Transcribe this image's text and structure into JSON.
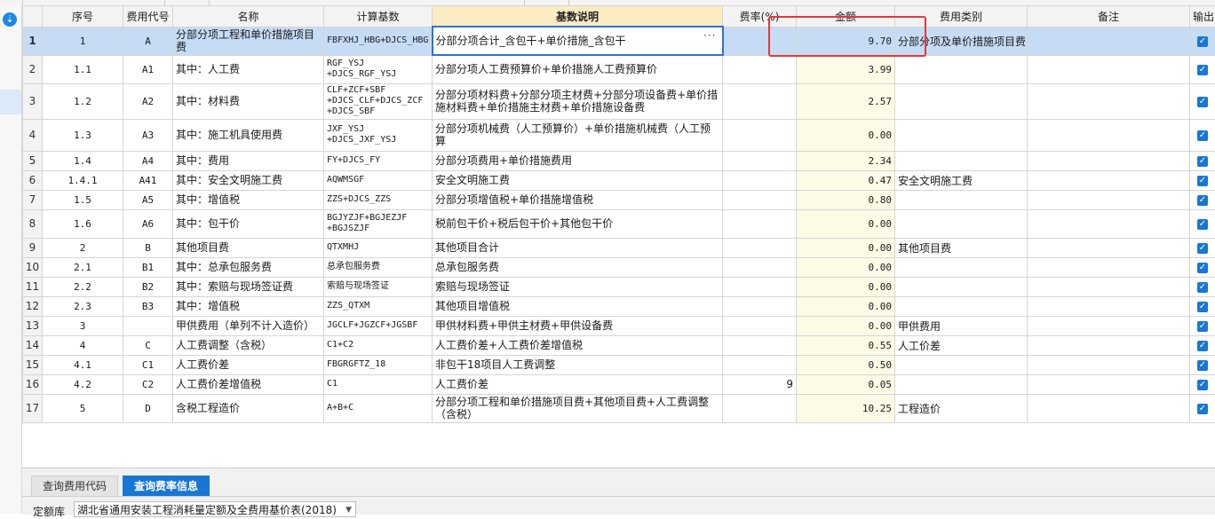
{
  "columns": {
    "seq": "序号",
    "code": "费用代号",
    "name": "名称",
    "base": "计算基数",
    "desc": "基数说明",
    "rate": "费率(%)",
    "amount": "金额",
    "category": "费用类别",
    "remark": "备注",
    "output": "输出"
  },
  "rows": [
    {
      "no": "1",
      "seq": "1",
      "code": "A",
      "name": "分部分项工程和单价措施项目费",
      "base": "FBFXHJ_HBG+DJCS_HBG",
      "desc": "分部分项合计_含包干+单价措施_含包干",
      "rate": "",
      "amount": "9.70",
      "category": "分部分项及单价措施项目费",
      "remark": ""
    },
    {
      "no": "2",
      "seq": "1.1",
      "code": "A1",
      "name": "其中：人工费",
      "base": "RGF_YSJ +DJCS_RGF_YSJ",
      "desc": "分部分项人工费预算价+单价措施人工费预算价",
      "rate": "",
      "amount": "3.99",
      "category": "",
      "remark": ""
    },
    {
      "no": "3",
      "seq": "1.2",
      "code": "A2",
      "name": "其中：材料费",
      "base": "CLF+ZCF+SBF +DJCS_CLF+DJCS_ZCF +DJCS_SBF",
      "desc": "分部分项材料费+分部分项主材费+分部分项设备费+单价措施材料费+单价措施主材费+单价措施设备费",
      "rate": "",
      "amount": "2.57",
      "category": "",
      "remark": ""
    },
    {
      "no": "4",
      "seq": "1.3",
      "code": "A3",
      "name": "其中：施工机具使用费",
      "base": "JXF_YSJ +DJCS_JXF_YSJ",
      "desc": "分部分项机械费（人工预算价）+单价措施机械费（人工预算",
      "rate": "",
      "amount": "0.00",
      "category": "",
      "remark": ""
    },
    {
      "no": "5",
      "seq": "1.4",
      "code": "A4",
      "name": "其中：费用",
      "base": "FY+DJCS_FY",
      "desc": "分部分项费用+单价措施费用",
      "rate": "",
      "amount": "2.34",
      "category": "",
      "remark": ""
    },
    {
      "no": "6",
      "seq": "1.4.1",
      "code": "A41",
      "name": "其中：安全文明施工费",
      "base": "AQWMSGF",
      "desc": "安全文明施工费",
      "rate": "",
      "amount": "0.47",
      "category": "安全文明施工费",
      "remark": ""
    },
    {
      "no": "7",
      "seq": "1.5",
      "code": "A5",
      "name": "其中：增值税",
      "base": "ZZS+DJCS_ZZS",
      "desc": "分部分项增值税+单价措施增值税",
      "rate": "",
      "amount": "0.80",
      "category": "",
      "remark": ""
    },
    {
      "no": "8",
      "seq": "1.6",
      "code": "A6",
      "name": "其中：包干价",
      "base": "BGJYZJF+BGJEZJF +BGJSZJF",
      "desc": "税前包干价+税后包干价+其他包干价",
      "rate": "",
      "amount": "0.00",
      "category": "",
      "remark": ""
    },
    {
      "no": "9",
      "seq": "2",
      "code": "B",
      "name": "其他项目费",
      "base": "QTXMHJ",
      "desc": "其他项目合计",
      "rate": "",
      "amount": "0.00",
      "category": "其他项目费",
      "remark": ""
    },
    {
      "no": "10",
      "seq": "2.1",
      "code": "B1",
      "name": "其中：总承包服务费",
      "base": "总承包服务费",
      "desc": "总承包服务费",
      "rate": "",
      "amount": "0.00",
      "category": "",
      "remark": ""
    },
    {
      "no": "11",
      "seq": "2.2",
      "code": "B2",
      "name": "其中：索赔与现场签证费",
      "base": "索赔与现场签证",
      "desc": "索赔与现场签证",
      "rate": "",
      "amount": "0.00",
      "category": "",
      "remark": ""
    },
    {
      "no": "12",
      "seq": "2.3",
      "code": "B3",
      "name": "其中：增值税",
      "base": "ZZS_QTXM",
      "desc": "其他项目增值税",
      "rate": "",
      "amount": "0.00",
      "category": "",
      "remark": ""
    },
    {
      "no": "13",
      "seq": "3",
      "code": "",
      "name": "甲供费用（单列不计入造价）",
      "base": "JGCLF+JGZCF+JGSBF",
      "desc": "甲供材料费+甲供主材费+甲供设备费",
      "rate": "",
      "amount": "0.00",
      "category": "甲供费用",
      "remark": ""
    },
    {
      "no": "14",
      "seq": "4",
      "code": "C",
      "name": "人工费调整（含税）",
      "base": "C1+C2",
      "desc": "人工费价差+人工费价差增值税",
      "rate": "",
      "amount": "0.55",
      "category": "人工价差",
      "remark": ""
    },
    {
      "no": "15",
      "seq": "4.1",
      "code": "C1",
      "name": "人工费价差",
      "base": "FBGRGFTZ_18",
      "desc": "非包干18项目人工费调整",
      "rate": "",
      "amount": "0.50",
      "category": "",
      "remark": ""
    },
    {
      "no": "16",
      "seq": "4.2",
      "code": "C2",
      "name": "人工费价差增值税",
      "base": "C1",
      "desc": "人工费价差",
      "rate": "9",
      "amount": "0.05",
      "category": "",
      "remark": ""
    },
    {
      "no": "17",
      "seq": "5",
      "code": "D",
      "name": "含税工程造价",
      "base": "A+B+C",
      "desc": "分部分项工程和单价措施项目费+其他项目费+人工费调整（含税）",
      "rate": "",
      "amount": "10.25",
      "category": "工程造价",
      "remark": ""
    }
  ],
  "bottom": {
    "tab_code": "查询费用代码",
    "tab_rate": "查询费率信息",
    "lib_label": "定额库",
    "lib_value": "湖北省通用安装工程消耗量定额及全费用基价表(2018)"
  },
  "icons": {
    "download": "download-circle-icon",
    "checkbox": "checkbox-checked-icon",
    "more": "ellipsis-icon"
  },
  "colors": {
    "selected_row": "#c6dcf5",
    "highlight_header": "#fdebc3",
    "amount_column": "#fdfbe6",
    "accent": "#1976d2",
    "annotation": "#e53935"
  }
}
